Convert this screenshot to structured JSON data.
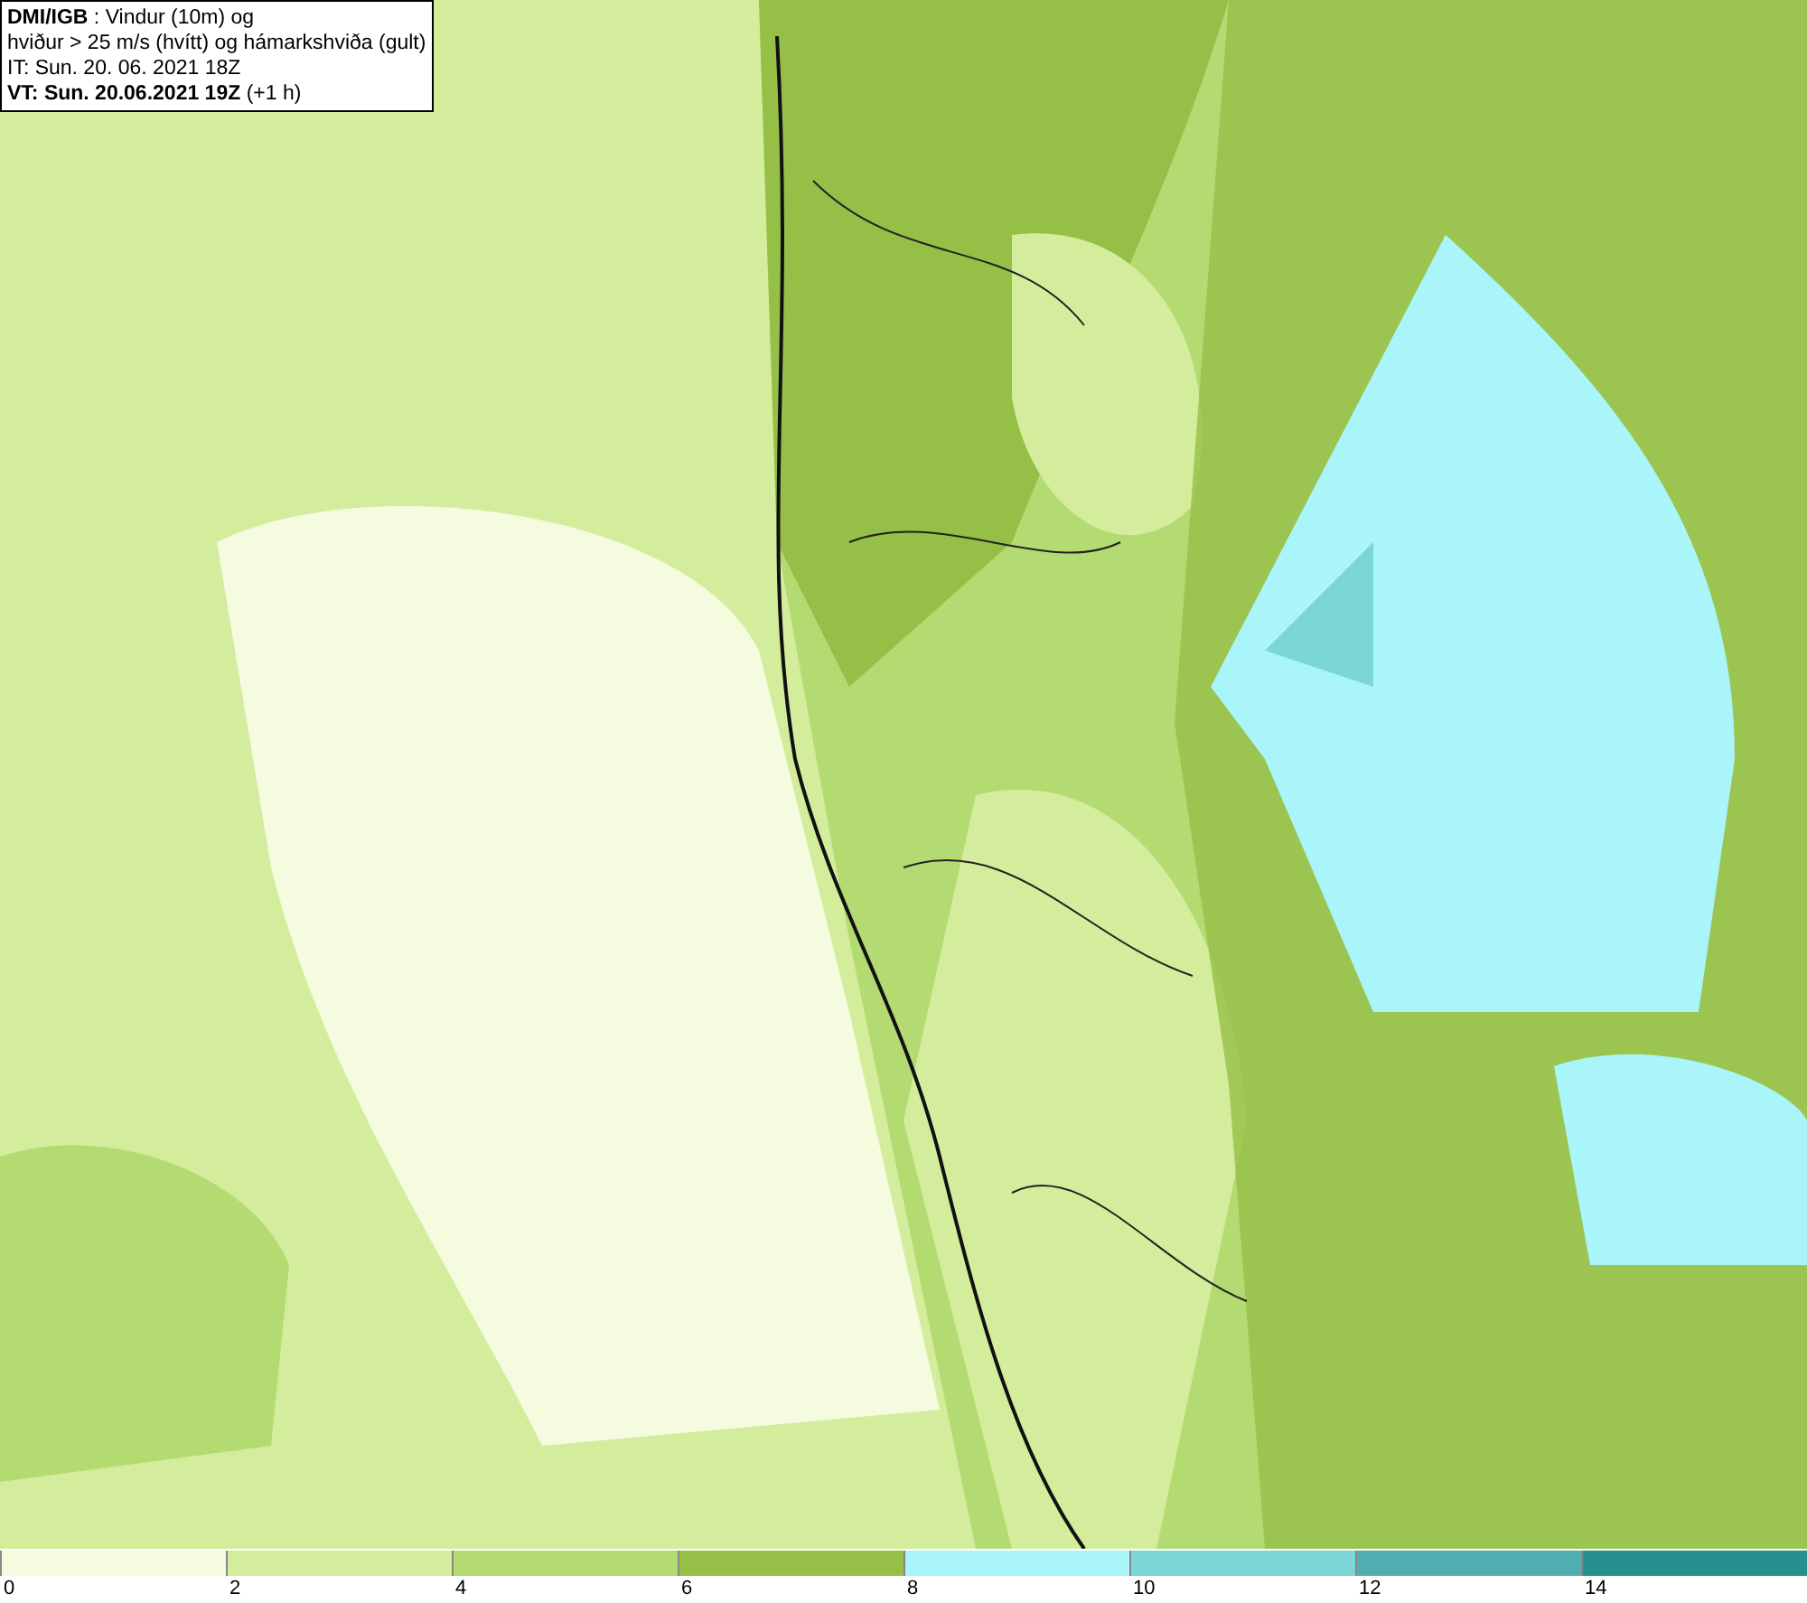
{
  "info_box": {
    "lines": [
      "**DMI/IGB** : Vindur (10m) og",
      "hviður > 25 m/s (hvítt) og hámarkshviða (gult)",
      "IT: Sun. 20. 06. 2021 18Z",
      "**VT: Sun. 20.06.2021 19Z** (+1 h)"
    ]
  },
  "colorbar": {
    "bins": [
      {
        "color": "#f4fbdf"
      },
      {
        "color": "#d4ed9c"
      },
      {
        "color": "#b4da72"
      },
      {
        "color": "#95bf47"
      },
      {
        "color": "#a9f5fa"
      },
      {
        "color": "#7cd5d7"
      },
      {
        "color": "#51afb1"
      },
      {
        "color": "#26908e"
      }
    ],
    "ticks": [
      "0",
      "2",
      "4",
      "6",
      "8",
      "10",
      "12",
      "14"
    ]
  }
}
